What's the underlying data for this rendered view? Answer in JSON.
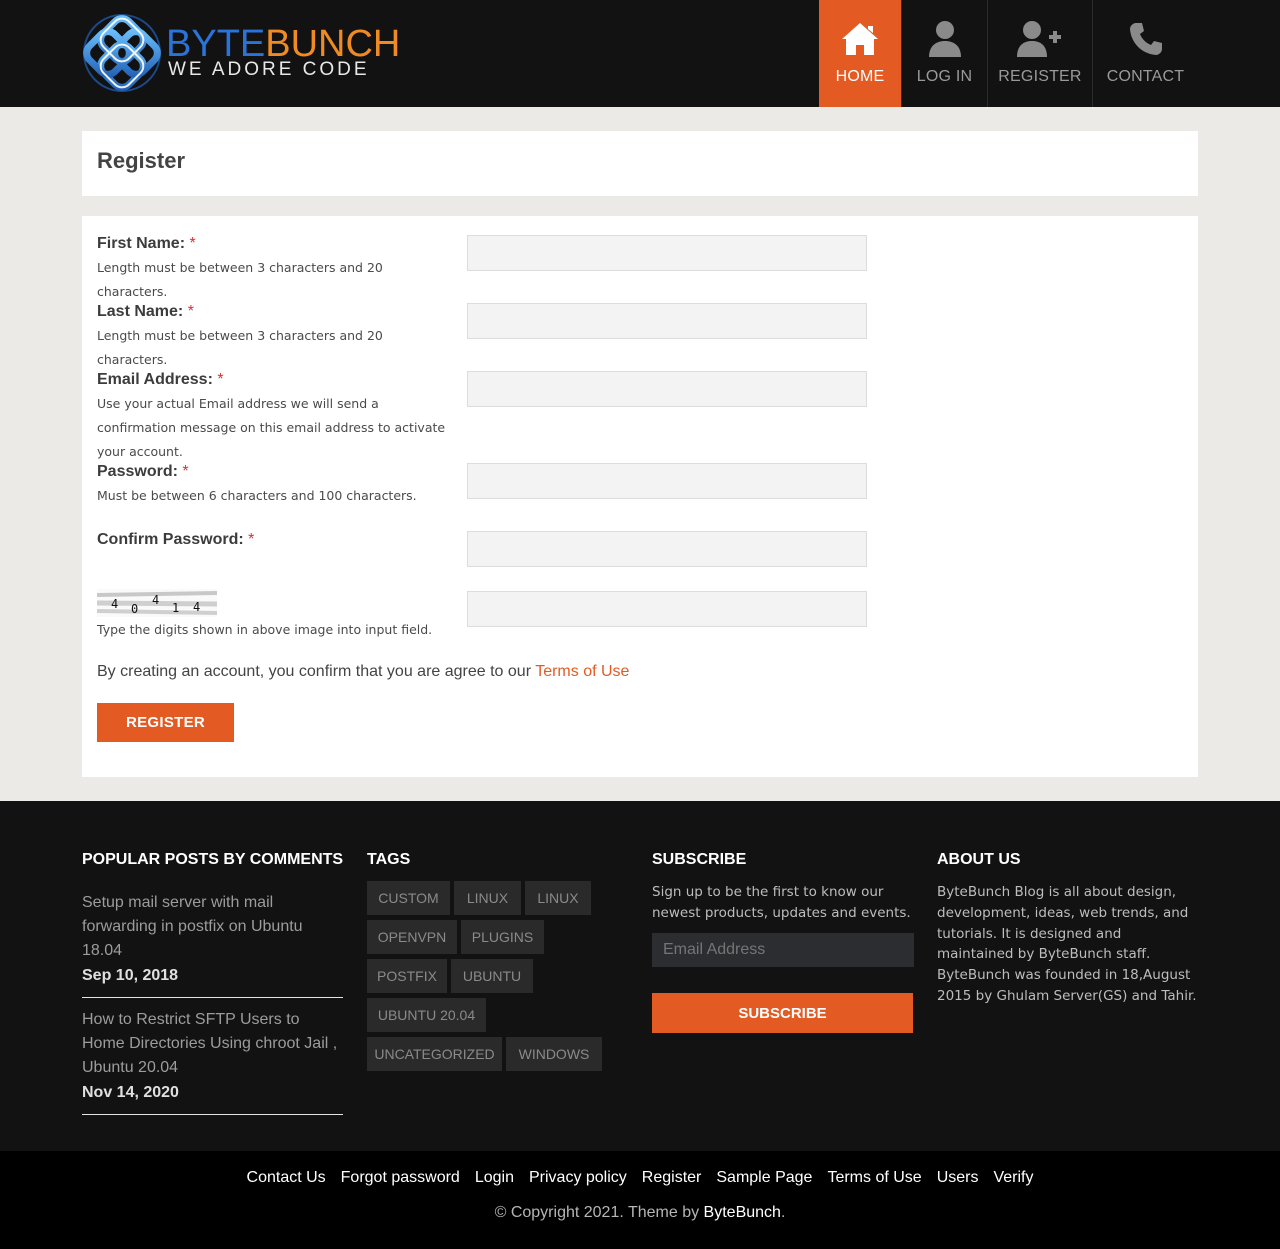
{
  "header": {
    "logo_word_1": "BYTE",
    "logo_word_2": "BUNCH",
    "logo_tagline": "WE ADORE CODE",
    "nav": [
      {
        "label": "HOME",
        "icon": "home-icon",
        "active": true
      },
      {
        "label": "LOG IN",
        "icon": "user-icon",
        "active": false
      },
      {
        "label": "REGISTER",
        "icon": "user-plus-icon",
        "active": false
      },
      {
        "label": "CONTACT",
        "icon": "phone-icon",
        "active": false
      }
    ]
  },
  "colors": {
    "accent": "#e35b22",
    "header_bg": "#121212",
    "page_bg": "#ebeae6"
  },
  "page": {
    "title": "Register"
  },
  "form": {
    "first_name": {
      "label": "First Name:",
      "required": "*",
      "help": "Length must be between 3 characters and 20 characters.",
      "value": ""
    },
    "last_name": {
      "label": "Last Name:",
      "required": "*",
      "help": "Length must be between 3 characters and 20 characters.",
      "value": ""
    },
    "email": {
      "label": "Email Address:",
      "required": "*",
      "help": "Use your actual Email address we will send a confirmation message on this email address to activate your account.",
      "value": ""
    },
    "password": {
      "label": "Password:",
      "required": "*",
      "help": "Must be between 6 characters and 100 characters.",
      "value": ""
    },
    "confirm_password": {
      "label": "Confirm Password:",
      "required": "*",
      "value": ""
    },
    "captcha": {
      "digits": [
        "4",
        "0",
        "4",
        "1",
        "4"
      ],
      "help": "Type the digits shown in above image into input field.",
      "value": ""
    },
    "agree_text": "By creating an account, you confirm that you are agree to our",
    "terms_link": "Terms of Use",
    "submit_label": "REGISTER"
  },
  "footer": {
    "popular": {
      "heading": "POPULAR POSTS BY COMMENTS",
      "posts": [
        {
          "title": "Setup mail server with mail forwarding in postfix on Ubuntu 18.04",
          "date": "Sep 10, 2018"
        },
        {
          "title": "How to Restrict SFTP Users to Home Directories Using chroot Jail , Ubuntu 20.04",
          "date": "Nov 14, 2020"
        }
      ]
    },
    "tags": {
      "heading": "TAGS",
      "items": [
        "CUSTOM",
        "LINUX",
        "LINUX",
        "OPENVPN",
        "PLUGINS",
        "POSTFIX",
        "UBUNTU",
        "UBUNTU 20.04",
        "UNCATEGORIZED",
        "WINDOWS"
      ]
    },
    "subscribe": {
      "heading": "SUBSCRIBE",
      "text": "Sign up to be the first to know our newest products, updates and events.",
      "placeholder": "Email Address",
      "button": "SUBSCRIBE"
    },
    "about": {
      "heading": "ABOUT US",
      "text": "ByteBunch Blog is all about design, development, ideas, web trends, and tutorials. It is designed and maintained by ByteBunch staff. ByteBunch was founded in 18,August 2015 by Ghulam Server(GS) and Tahir."
    },
    "links": [
      "Contact Us",
      "Forgot password",
      "Login",
      "Privacy policy",
      "Register",
      "Sample Page",
      "Terms of Use",
      "Users",
      "Verify"
    ],
    "copyright_prefix": "© Copyright 2021. Theme by",
    "copyright_brand": "ByteBunch",
    "copyright_suffix": "."
  }
}
